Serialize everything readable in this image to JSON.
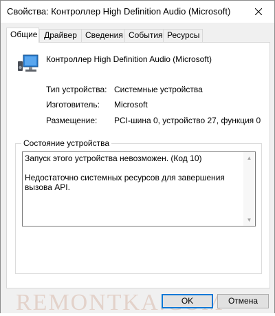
{
  "window": {
    "title": "Свойства: Контроллер High Definition Audio (Microsoft)"
  },
  "tabs": [
    {
      "label": "Общие",
      "active": true
    },
    {
      "label": "Драйвер"
    },
    {
      "label": "Сведения"
    },
    {
      "label": "События"
    },
    {
      "label": "Ресурсы"
    }
  ],
  "device": {
    "icon": "speaker-monitor-icon",
    "name": "Контроллер High Definition Audio (Microsoft)"
  },
  "properties": [
    {
      "label": "Тип устройства:",
      "value": "Системные устройства"
    },
    {
      "label": "Изготовитель:",
      "value": "Microsoft"
    },
    {
      "label": "Размещение:",
      "value": "PCI-шина 0, устройство 27, функция 0"
    }
  ],
  "status": {
    "title": "Состояние устройства",
    "text": "Запуск этого устройства невозможен. (Код 10)\n\nНедостаточно системных ресурсов для завершения вызова API."
  },
  "buttons": {
    "ok": "OK",
    "cancel": "Отмена"
  },
  "watermark": "REMONTKA.COM",
  "colors": {
    "accent": "#0078d7"
  }
}
